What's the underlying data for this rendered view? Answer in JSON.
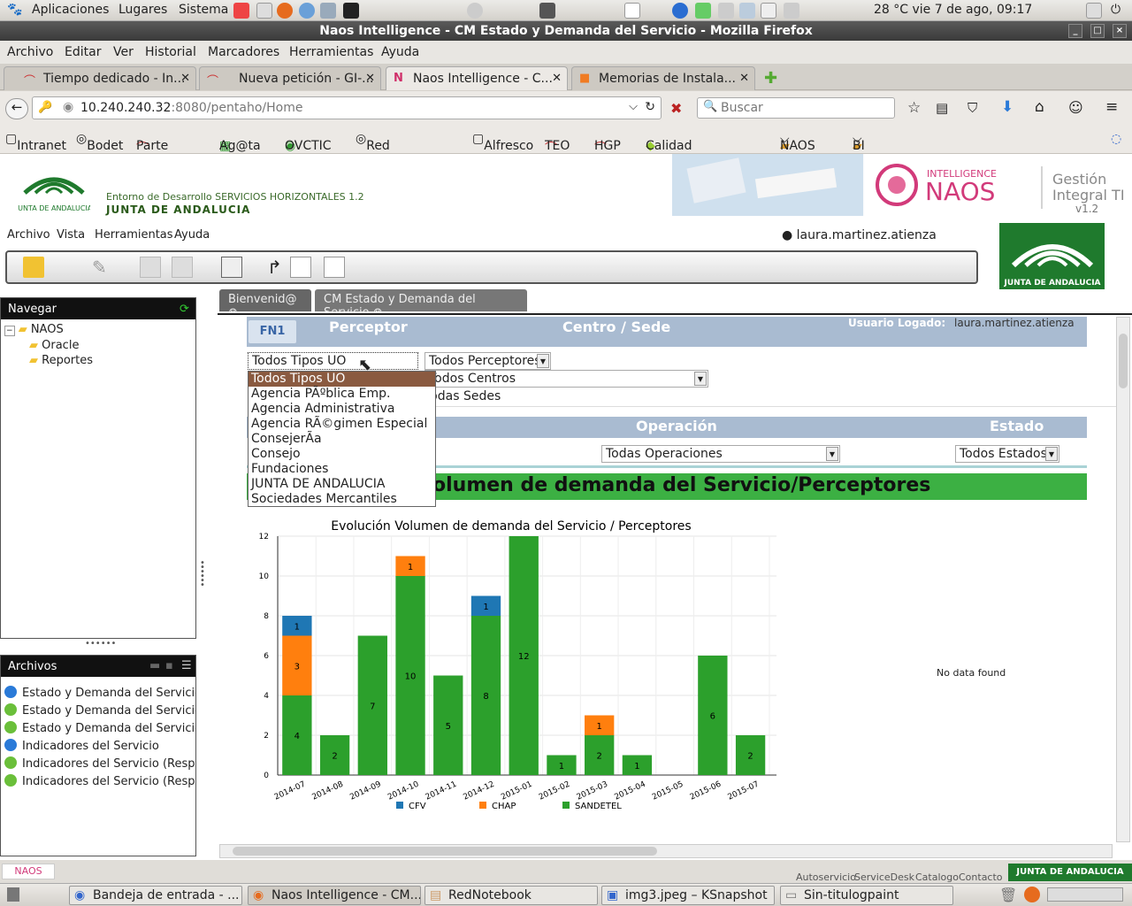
{
  "gnome": {
    "menu": [
      "Aplicaciones",
      "Lugares",
      "Sistema"
    ],
    "clock": "28 °C vie  7 de ago, 09:17"
  },
  "window": {
    "title": "Naos Intelligence - CM Estado y Demanda del Servicio - Mozilla Firefox"
  },
  "firefox_menu": [
    "Archivo",
    "Editar",
    "Ver",
    "Historial",
    "Marcadores",
    "Herramientas",
    "Ayuda"
  ],
  "tabs": [
    {
      "label": "Tiempo dedicado - In..."
    },
    {
      "label": "Nueva petición - GI-..."
    },
    {
      "label": "Naos Intelligence - C..."
    },
    {
      "label": "Memorias de Instala..."
    }
  ],
  "url": {
    "host": "10.240.240.32",
    "rest": ":8080/pentaho/Home"
  },
  "search": {
    "placeholder": "Buscar"
  },
  "bookmarks": [
    "Intranet",
    "Bodet",
    "Parte HGP",
    "Ag@ta",
    "OVCTIC",
    "Red Profesional",
    "Alfresco",
    "TEO",
    "HGP",
    "Calidad SANDETEL",
    "NAOS",
    "BI"
  ],
  "header": {
    "env": "Entorno de Desarrollo SERVICIOS HORIZONTALES 1.2",
    "org": "JUNTA DE ANDALUCIA",
    "logo_text": "JUNTA DE ANDALUCIA",
    "banner_brand": "NAOS",
    "banner_small": "INTELLIGENCE",
    "banner_gestion": "Gestión",
    "banner_integral": "Integral TI",
    "banner_version": "v1.2"
  },
  "pentaho_menu": [
    "Archivo",
    "Vista",
    "Herramientas",
    "Ayuda"
  ],
  "user": "laura.martinez.atienza",
  "nav_panel": {
    "title": "Navegar",
    "root": "NAOS",
    "children": [
      "Oracle",
      "Reportes"
    ]
  },
  "files_panel": {
    "title": "Archivos",
    "items": [
      "Estado y Demanda del Servicio",
      "Estado y Demanda del Servicio (R",
      "Estado y Demanda del Servicio (R",
      "Indicadores del Servicio",
      "Indicadores del Servicio (Resp Ser",
      "Indicadores del Servicio (Resp Ser"
    ]
  },
  "content_tabs": [
    "Bienvenid@",
    "CM Estado y Demanda del Servicio"
  ],
  "dashboard": {
    "fn_label": "FN1",
    "perceptor": "Perceptor",
    "centro": "Centro / Sede",
    "usuario_logado_label": "Usuario Logado:",
    "usuario_logado": "laura.martinez.atienza",
    "tipos_uo": "Todos Tipos UO",
    "perceptores": "Todos Perceptores",
    "centros": "Todos Centros",
    "sedes": "Todas Sedes",
    "operacion": "Operación",
    "estado": "Estado",
    "operaciones": "Todas Operaciones",
    "estados": "Todos Estados",
    "section_title": "Volumen de demanda del Servicio/Perceptores",
    "section_title_visible": "olumen de demanda del Servicio/Perceptores",
    "no_data": "No data found"
  },
  "dropdown_options": [
    "Todos Tipos UO",
    "Agencia PÃºblica Emp.",
    "Agencia Administrativa",
    "Agencia RÃ©gimen Especial",
    "ConsejerÃa",
    "Consejo",
    "Fundaciones",
    "JUNTA DE ANDALUCIA",
    "Sociedades Mercantiles"
  ],
  "chart_data": {
    "type": "bar",
    "stacked": true,
    "title": "Evolución Volumen de demanda del Servicio / Perceptores",
    "categories": [
      "2014-07",
      "2014-08",
      "2014-09",
      "2014-10",
      "2014-11",
      "2014-12",
      "2015-01",
      "2015-02",
      "2015-03",
      "2015-04",
      "2015-05",
      "2015-06",
      "2015-07"
    ],
    "series": [
      {
        "name": "SANDETEL",
        "color": "#2ca02c",
        "values": [
          4,
          2,
          7,
          10,
          5,
          8,
          12,
          1,
          2,
          1,
          0,
          6,
          2
        ]
      },
      {
        "name": "CHAP",
        "color": "#ff7f0e",
        "values": [
          3,
          0,
          0,
          1,
          0,
          0,
          0,
          0,
          1,
          0,
          0,
          0,
          0
        ]
      },
      {
        "name": "CFV",
        "color": "#1f77b4",
        "values": [
          1,
          0,
          0,
          0,
          0,
          1,
          0,
          0,
          0,
          0,
          0,
          0,
          0
        ]
      }
    ],
    "legend_order": [
      "CFV",
      "CHAP",
      "SANDETEL"
    ],
    "ylim": [
      0,
      12
    ],
    "yticks": [
      0,
      2,
      4,
      6,
      8,
      10,
      12
    ],
    "grid": true,
    "legend": "bottom"
  },
  "status_links": [
    "Autoservicio",
    "ServiceDesk",
    "Catalogo",
    "Contacto"
  ],
  "status_brand": "JUNTA DE ANDALUCIA",
  "status_logo": "NAOS",
  "taskbar": [
    "Bandeja de entrada - ...",
    "Naos Intelligence - CM...",
    "RedNotebook",
    "img3.jpeg – KSnapshot",
    "Sin-titulogpaint"
  ]
}
